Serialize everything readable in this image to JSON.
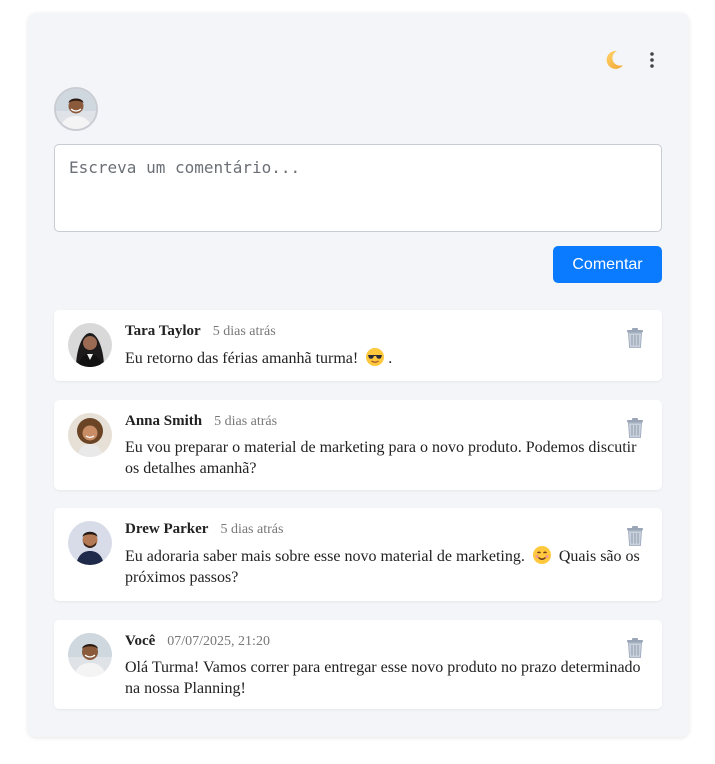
{
  "header": {
    "theme_icon": "moon-icon",
    "menu_icon": "kebab-menu-icon"
  },
  "composer": {
    "placeholder": "Escreva um comentário...",
    "submit_label": "Comentar",
    "accent_color": "#0a7bff"
  },
  "comments": [
    {
      "author": "Tara Taylor",
      "time": "5 dias atrás",
      "text_before": "Eu retorno das férias amanhã turma!",
      "emoji": "sunglasses-emoji",
      "text_after": ".",
      "avatar": "woman-dark-hair-avatar"
    },
    {
      "author": "Anna Smith",
      "time": "5 dias atrás",
      "text_before": "Eu vou preparar o material de marketing para o novo produto. Podemos discutir os detalhes amanhã?",
      "emoji": "",
      "text_after": "",
      "avatar": "woman-curly-hair-avatar"
    },
    {
      "author": "Drew Parker",
      "time": "5 dias atrás",
      "text_before": "Eu adoraria saber mais sobre esse novo material de marketing.",
      "emoji": "smiling-emoji",
      "text_after": "Quais são os próximos passos?",
      "avatar": "man-beard-avatar"
    },
    {
      "author": "Você",
      "time": "07/07/2025, 21:20",
      "text_before": "Olá Turma! Vamos correr para entregar esse novo produto no prazo determinado na nossa Planning!",
      "emoji": "",
      "text_after": "",
      "avatar": "man-smiling-avatar"
    }
  ]
}
